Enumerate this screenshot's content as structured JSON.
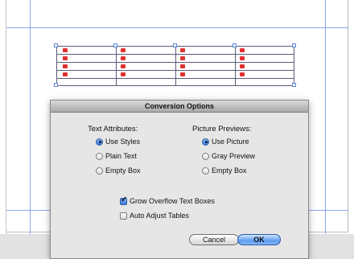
{
  "dialog": {
    "title": "Conversion Options",
    "text_attributes": {
      "label": "Text Attributes:",
      "options": [
        "Use Styles",
        "Plain Text",
        "Empty Box"
      ],
      "selected": "Use Styles"
    },
    "picture_previews": {
      "label": "Picture Previews:",
      "options": [
        "Use Picture",
        "Gray Preview",
        "Empty Box"
      ],
      "selected": "Use Picture"
    },
    "checkboxes": [
      {
        "label": "Grow Overflow Text Boxes",
        "checked": true
      },
      {
        "label": "Auto Adjust Tables",
        "checked": false
      }
    ],
    "cancel_label": "Cancel",
    "ok_label": "OK"
  },
  "colors": {
    "guide": "#8aa8f0",
    "cell_marker": "#e03030",
    "default_button": "#5f9ef0"
  }
}
